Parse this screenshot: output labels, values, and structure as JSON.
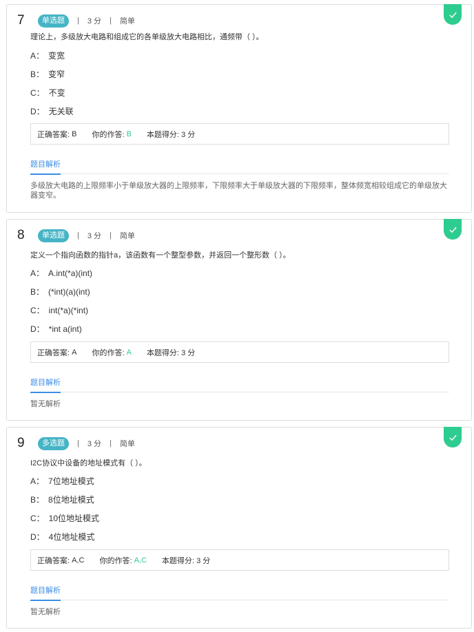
{
  "questions": [
    {
      "number": "7",
      "type": "单选题",
      "score": "3 分",
      "difficulty": "简单",
      "stem": "理论上，多级放大电路和组成它的各单级放大电路相比，通频带（ ）。",
      "options": [
        {
          "key": "A：",
          "text": "变宽"
        },
        {
          "key": "B：",
          "text": "变窄"
        },
        {
          "key": "C：",
          "text": "不变"
        },
        {
          "key": "D：",
          "text": "无关联"
        }
      ],
      "correct_label": "正确答案:",
      "correct": "B",
      "your_label": "你的作答:",
      "your": "B",
      "got_label": "本题得分:",
      "got": "3 分",
      "tab": "题目解析",
      "analysis": "多级放大电路的上限频率小于单级放大器的上限频率，下限频率大于单级放大器的下限频率，整体频宽相较组成它的单级放大器变窄。"
    },
    {
      "number": "8",
      "type": "单选题",
      "score": "3 分",
      "difficulty": "简单",
      "stem": "定义一个指向函数的指针a，该函数有一个整型参数，并返回一个整形数（ ）。",
      "options": [
        {
          "key": "A：",
          "text": "A.int(*a)(int)"
        },
        {
          "key": "B：",
          "text": "(*int)(a)(int)"
        },
        {
          "key": "C：",
          "text": "int(*a)(*int)"
        },
        {
          "key": "D：",
          "text": "*int a(int)"
        }
      ],
      "correct_label": "正确答案:",
      "correct": "A",
      "your_label": "你的作答:",
      "your": "A",
      "got_label": "本题得分:",
      "got": "3 分",
      "tab": "题目解析",
      "analysis": "暂无解析"
    },
    {
      "number": "9",
      "type": "多选题",
      "score": "3 分",
      "difficulty": "简单",
      "stem": "I2C协议中设备的地址模式有（ ）。",
      "options": [
        {
          "key": "A：",
          "text": "7位地址模式"
        },
        {
          "key": "B：",
          "text": "8位地址模式"
        },
        {
          "key": "C：",
          "text": "10位地址模式"
        },
        {
          "key": "D：",
          "text": "4位地址模式"
        }
      ],
      "correct_label": "正确答案:",
      "correct": "A,C",
      "your_label": "你的作答:",
      "your": "A,C",
      "got_label": "本题得分:",
      "got": "3 分",
      "tab": "题目解析",
      "analysis": "暂无解析"
    }
  ],
  "colors": {
    "accent": "#45b5c6",
    "correct": "#2ecc8f",
    "link": "#3a8ee6"
  },
  "icons": {
    "status": "check-icon"
  }
}
